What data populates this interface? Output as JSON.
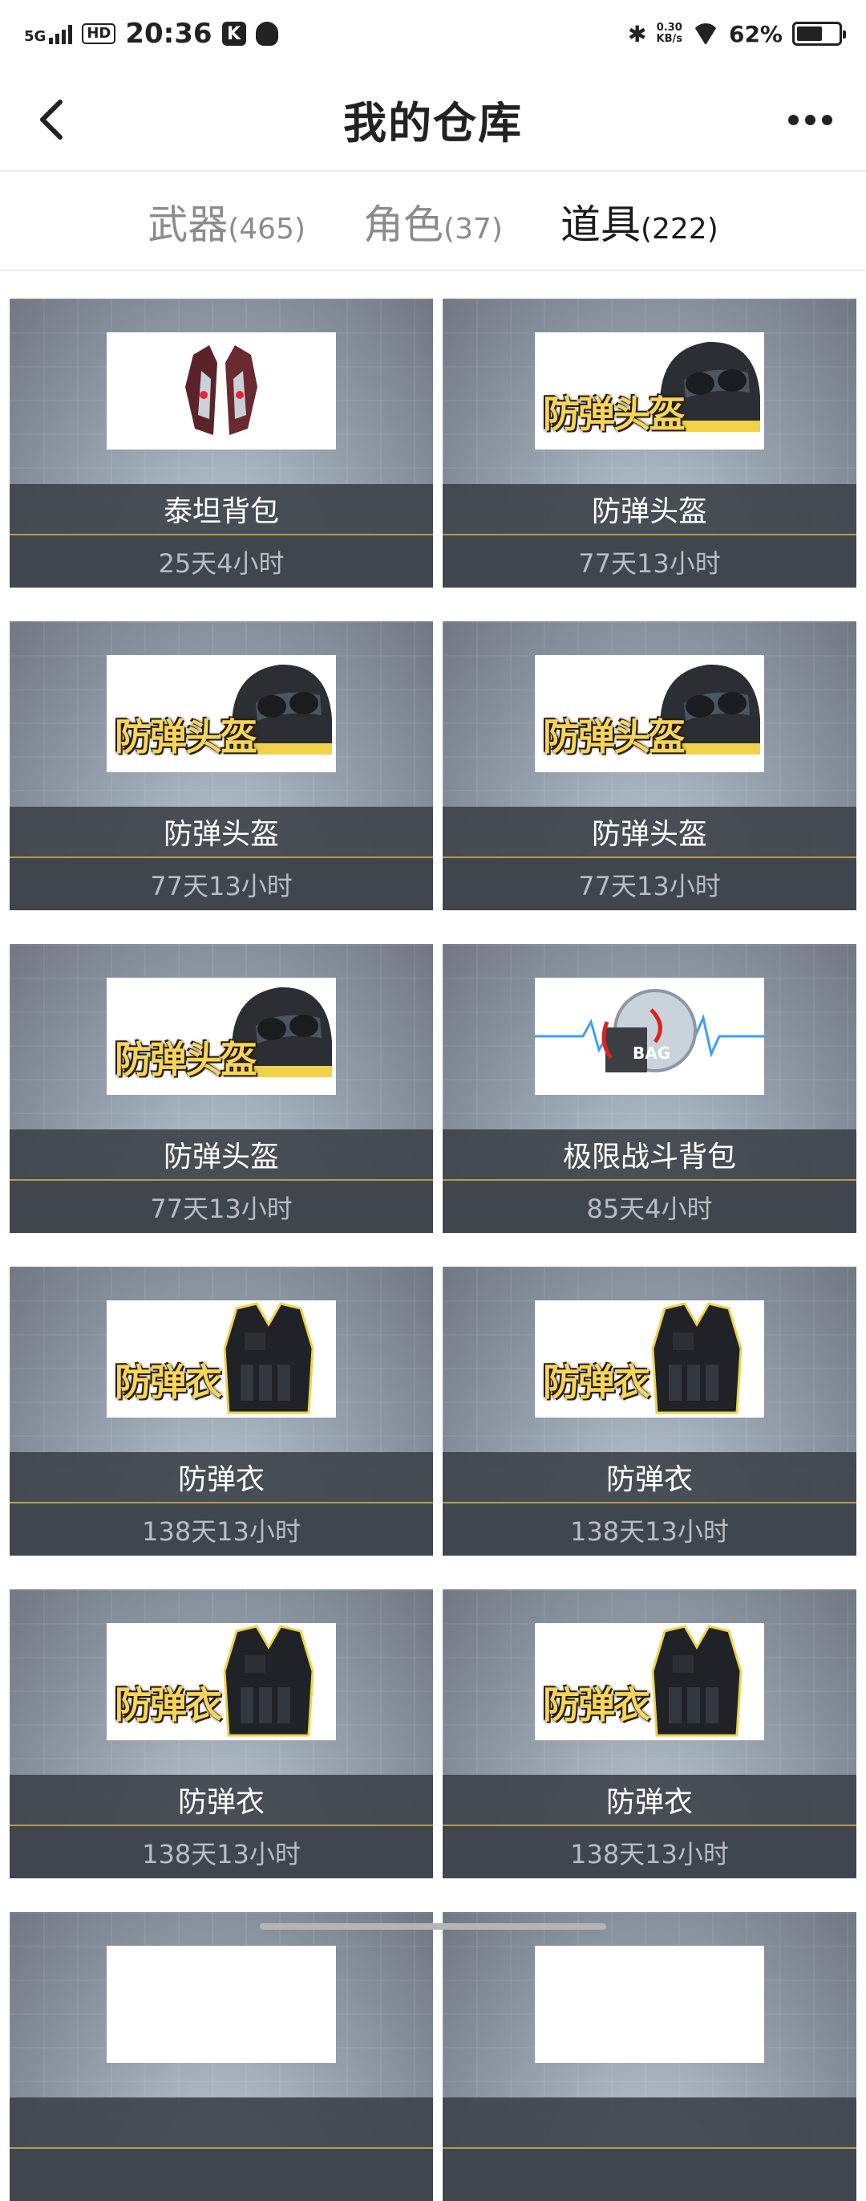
{
  "status_bar": {
    "network": "5G",
    "hd": "HD",
    "time": "20:36",
    "k_badge": "K",
    "speed_value": "0.30",
    "speed_unit": "KB/s",
    "battery": "62%",
    "battery_level": 0.62,
    "icons": [
      "signal-icon",
      "qq-icon",
      "bluetooth-icon",
      "wifi-icon",
      "battery-icon"
    ]
  },
  "header": {
    "title": "我的仓库"
  },
  "tabs": [
    {
      "label": "武器",
      "count": "(465)",
      "active": false
    },
    {
      "label": "角色",
      "count": "(37)",
      "active": false
    },
    {
      "label": "道具",
      "count": "(222)",
      "active": true
    }
  ],
  "items": [
    {
      "name": "泰坦背包",
      "duration": "25天4小时",
      "icon": "titan-backpack-icon",
      "caption": ""
    },
    {
      "name": "防弹头盔",
      "duration": "77天13小时",
      "icon": "helmet-icon",
      "caption": "防弹头盔"
    },
    {
      "name": "防弹头盔",
      "duration": "77天13小时",
      "icon": "helmet-icon",
      "caption": "防弹头盔"
    },
    {
      "name": "防弹头盔",
      "duration": "77天13小时",
      "icon": "helmet-icon",
      "caption": "防弹头盔"
    },
    {
      "name": "防弹头盔",
      "duration": "77天13小时",
      "icon": "helmet-icon",
      "caption": "防弹头盔"
    },
    {
      "name": "极限战斗背包",
      "duration": "85天4小时",
      "icon": "combat-bag-icon",
      "caption": "BAG"
    },
    {
      "name": "防弹衣",
      "duration": "138天13小时",
      "icon": "vest-icon",
      "caption": "防弹衣"
    },
    {
      "name": "防弹衣",
      "duration": "138天13小时",
      "icon": "vest-icon",
      "caption": "防弹衣"
    },
    {
      "name": "防弹衣",
      "duration": "138天13小时",
      "icon": "vest-icon",
      "caption": "防弹衣"
    },
    {
      "name": "防弹衣",
      "duration": "138天13小时",
      "icon": "vest-icon",
      "caption": "防弹衣"
    },
    {
      "name": "",
      "duration": "",
      "icon": "",
      "caption": ""
    },
    {
      "name": "",
      "duration": "",
      "icon": "",
      "caption": ""
    }
  ]
}
